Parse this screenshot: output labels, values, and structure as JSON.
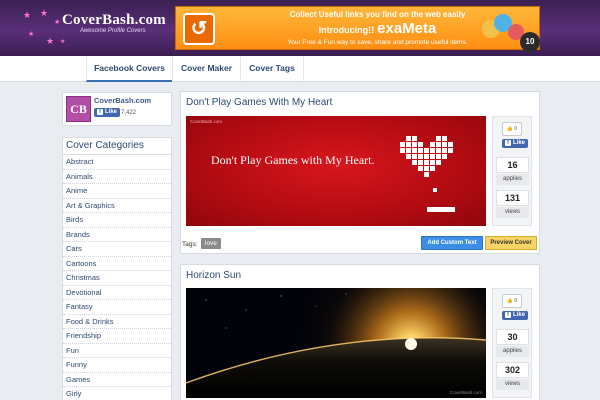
{
  "header": {
    "logo_title": "CoverBash.com",
    "logo_tagline": "Awesome Profile Covers",
    "banner": {
      "line1": "Collect Useful links you find on the web easily",
      "introducing": "Introducing!!",
      "product": "exaMeta",
      "line3": "Your Free & Fun way to save, share and promote useful items."
    }
  },
  "nav": {
    "items": [
      {
        "label": "Facebook Covers"
      },
      {
        "label": "Cover Maker"
      },
      {
        "label": "Cover Tags"
      }
    ]
  },
  "sidebar": {
    "page_box": {
      "logo_text": "CB",
      "name": "CoverBash.com",
      "like_label": "Like",
      "like_count": "7,422"
    },
    "categories_title": "Cover Categories",
    "categories": [
      "Abstract",
      "Animals",
      "Anime",
      "Art & Graphics",
      "Birds",
      "Brands",
      "Cars",
      "Cartoons",
      "Christmas",
      "Devotional",
      "Fantasy",
      "Food & Drinks",
      "Friendship",
      "Fun",
      "Funny",
      "Games",
      "Girly"
    ]
  },
  "covers": [
    {
      "title": "Don't Play Games With My Heart",
      "image_text": "Don't Play Games with My Heart.",
      "watermark": "CoverBash.com",
      "like_small": "0",
      "like_label": "Like",
      "applies": "16",
      "applies_label": "applies",
      "views": "131",
      "views_label": "views",
      "tags_label": "Tags:",
      "tag": "love",
      "custom_text_btn": "Add Custom Text",
      "preview_btn": "Preview Cover",
      "colors": {
        "bg": "#b20b12",
        "text": "#ffffff"
      }
    },
    {
      "title": "Horizon Sun",
      "watermark": "CoverBash.com",
      "like_small": "0",
      "like_label": "Like",
      "applies": "30",
      "applies_label": "applies",
      "views": "302",
      "views_label": "views"
    }
  ]
}
